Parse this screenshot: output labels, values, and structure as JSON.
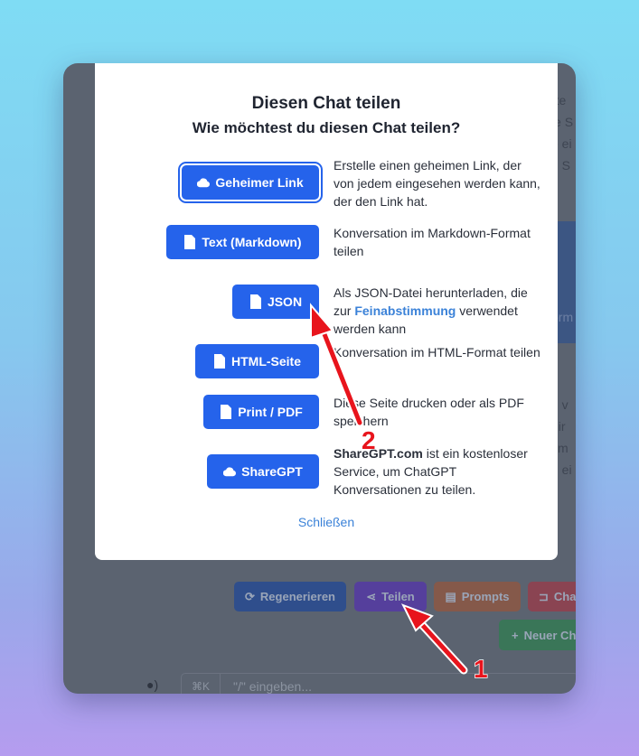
{
  "modal": {
    "title": "Diesen Chat teilen",
    "subtitle": "Wie möchtest du diesen Chat teilen?",
    "options": [
      {
        "label": "Geheimer Link",
        "icon": "cloud-icon",
        "desc": "Erstelle einen geheimen Link, der von jedem eingesehen werden kann, der den Link hat."
      },
      {
        "label": "Text (Markdown)",
        "icon": "document-icon",
        "desc": "Konversation im Markdown-Format teilen"
      },
      {
        "label": "JSON",
        "icon": "json-file-icon",
        "desc_pre": "Als JSON-Datei herunterladen, die zur ",
        "desc_link": "Feinabstimmung",
        "desc_post": " verwendet werden kann"
      },
      {
        "label": "HTML-Seite",
        "icon": "document-icon",
        "desc": "Konversation im HTML-Format teilen"
      },
      {
        "label": "Print / PDF",
        "icon": "pdf-icon",
        "desc": "Diese Seite drucken oder als PDF speichern"
      },
      {
        "label": "ShareGPT",
        "icon": "cloud-icon",
        "desc_bold": "ShareGPT.com",
        "desc_post": " ist ein kostenloser Service, um ChatGPT Konversationen zu teilen."
      }
    ],
    "close_label": "Schließen"
  },
  "background": {
    "fragments": [
      "rte",
      "ie S",
      "e ei",
      "n S",
      "orm",
      "n v",
      "dir",
      "tim",
      "n ei"
    ]
  },
  "toolbar": {
    "regenerate": "Regenerieren",
    "share": "Teilen",
    "prompts": "Prompts",
    "chat": "Cha",
    "new_chat": "Neuer Ch"
  },
  "input": {
    "shortcut": "⌘K",
    "placeholder": "\"/\" eingeben..."
  },
  "annotations": {
    "step1": "1",
    "step2": "2"
  },
  "colors": {
    "primary": "#2563eb",
    "arrow": "#e8141c"
  }
}
